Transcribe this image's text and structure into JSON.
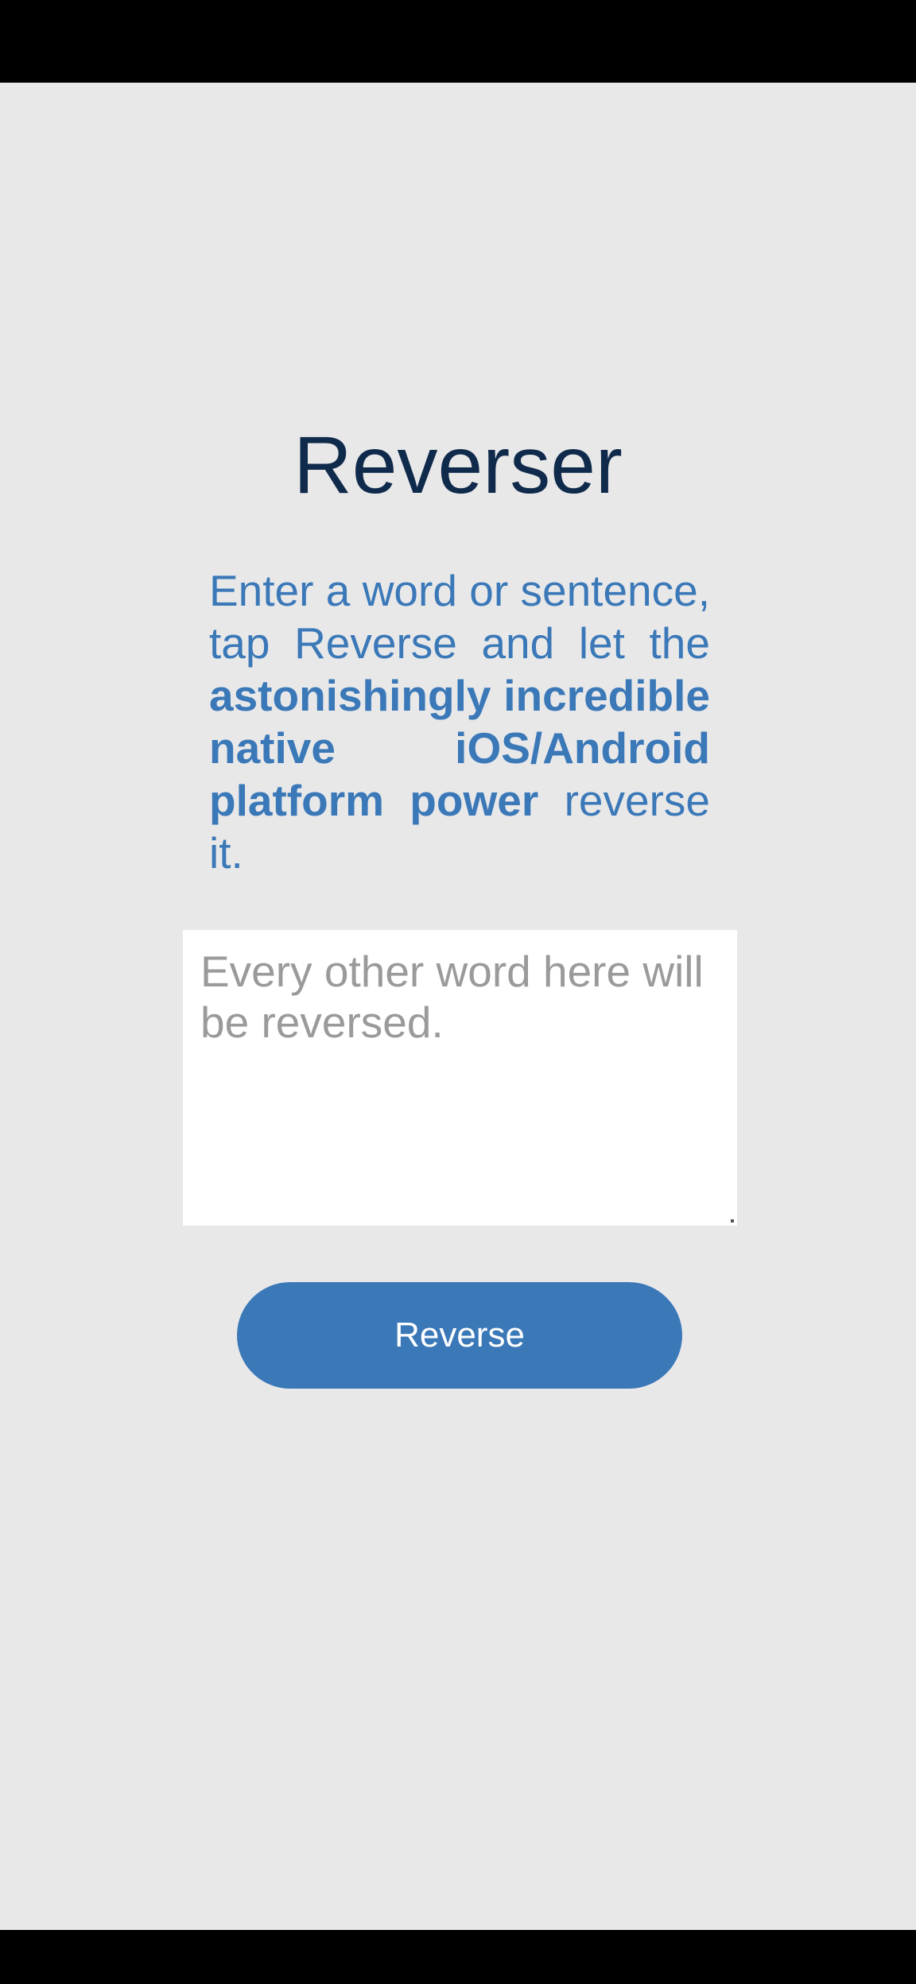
{
  "app": {
    "title": "Reverser"
  },
  "description": {
    "part1": "Enter a word or sentence, tap Reverse and let the ",
    "bold": "astonishingly incredible native iOS/Android platform power",
    "part2": " reverse it."
  },
  "input": {
    "placeholder": "Every other word here will be reversed.",
    "value": ""
  },
  "button": {
    "label": "Reverse"
  },
  "colors": {
    "background": "#e8e8e9",
    "title": "#102a4c",
    "accent": "#3a78b8",
    "button_text": "#ffffff",
    "placeholder": "#9a9a9a"
  }
}
